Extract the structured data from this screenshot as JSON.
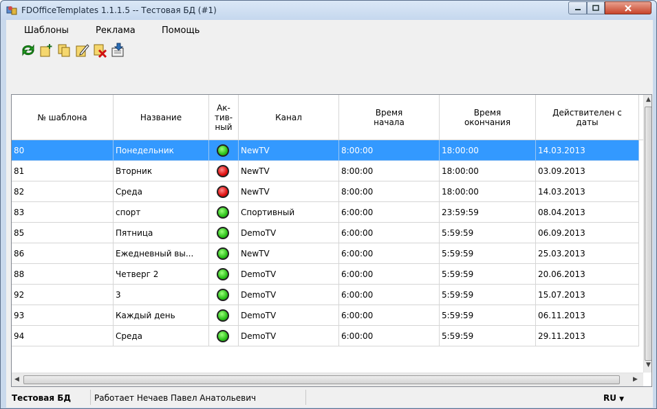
{
  "window": {
    "title": "FDOfficeTemplates 1.1.1.5 -- Тестовая БД (#1)"
  },
  "menu": [
    "Шаблоны",
    "Реклама",
    "Помощь"
  ],
  "toolbar": [
    {
      "name": "refresh-icon",
      "color": "#1e9e1e"
    },
    {
      "name": "add-template-icon",
      "color": "#c89c1a"
    },
    {
      "name": "copy-template-icon",
      "color": "#c89c1a"
    },
    {
      "name": "edit-template-icon",
      "color": "#c89c1a"
    },
    {
      "name": "delete-template-icon",
      "color": "#d01010"
    },
    {
      "name": "export-icon",
      "color": "#2a6db5"
    }
  ],
  "table": {
    "columns": [
      "№ шаблона",
      "Название",
      "Ак-\nтив-\nный",
      "Канал",
      "Время\nначала",
      "Время\nокончания",
      "Действителен с\nдаты"
    ],
    "rows": [
      {
        "num": "80",
        "name": "Понедельник",
        "active": true,
        "channel": "NewTV",
        "start": "8:00:00",
        "end": "18:00:00",
        "date": "14.03.2013",
        "selected": true
      },
      {
        "num": "81",
        "name": "Вторник",
        "active": false,
        "channel": "NewTV",
        "start": "8:00:00",
        "end": "18:00:00",
        "date": "03.09.2013"
      },
      {
        "num": "82",
        "name": "Среда",
        "active": false,
        "channel": "NewTV",
        "start": "8:00:00",
        "end": "18:00:00",
        "date": "14.03.2013"
      },
      {
        "num": "83",
        "name": "спорт",
        "active": true,
        "channel": "Спортивный",
        "start": "6:00:00",
        "end": "23:59:59",
        "date": "08.04.2013"
      },
      {
        "num": "85",
        "name": "Пятница",
        "active": true,
        "channel": "DemoTV",
        "start": "6:00:00",
        "end": "5:59:59",
        "date": "06.09.2013"
      },
      {
        "num": "86",
        "name": "Ежедневный вы...",
        "active": true,
        "channel": "NewTV",
        "start": "6:00:00",
        "end": "5:59:59",
        "date": "25.03.2013"
      },
      {
        "num": "88",
        "name": "Четверг 2",
        "active": true,
        "channel": "DemoTV",
        "start": "6:00:00",
        "end": "5:59:59",
        "date": "20.06.2013"
      },
      {
        "num": "92",
        "name": "3",
        "active": true,
        "channel": "DemoTV",
        "start": "6:00:00",
        "end": "5:59:59",
        "date": "15.07.2013"
      },
      {
        "num": "93",
        "name": "Каждый день",
        "active": true,
        "channel": "DemoTV",
        "start": "6:00:00",
        "end": "5:59:59",
        "date": "06.11.2013"
      },
      {
        "num": "94",
        "name": "Среда",
        "active": true,
        "channel": "DemoTV",
        "start": "6:00:00",
        "end": "5:59:59",
        "date": "29.11.2013"
      }
    ]
  },
  "status": {
    "db": "Тестовая БД",
    "user": "Работает Нечаев Павел Анатольевич",
    "lang": "RU"
  },
  "colors": {
    "selection": "#3399ff",
    "active_on": "#2cc21a",
    "active_off": "#e01010"
  }
}
